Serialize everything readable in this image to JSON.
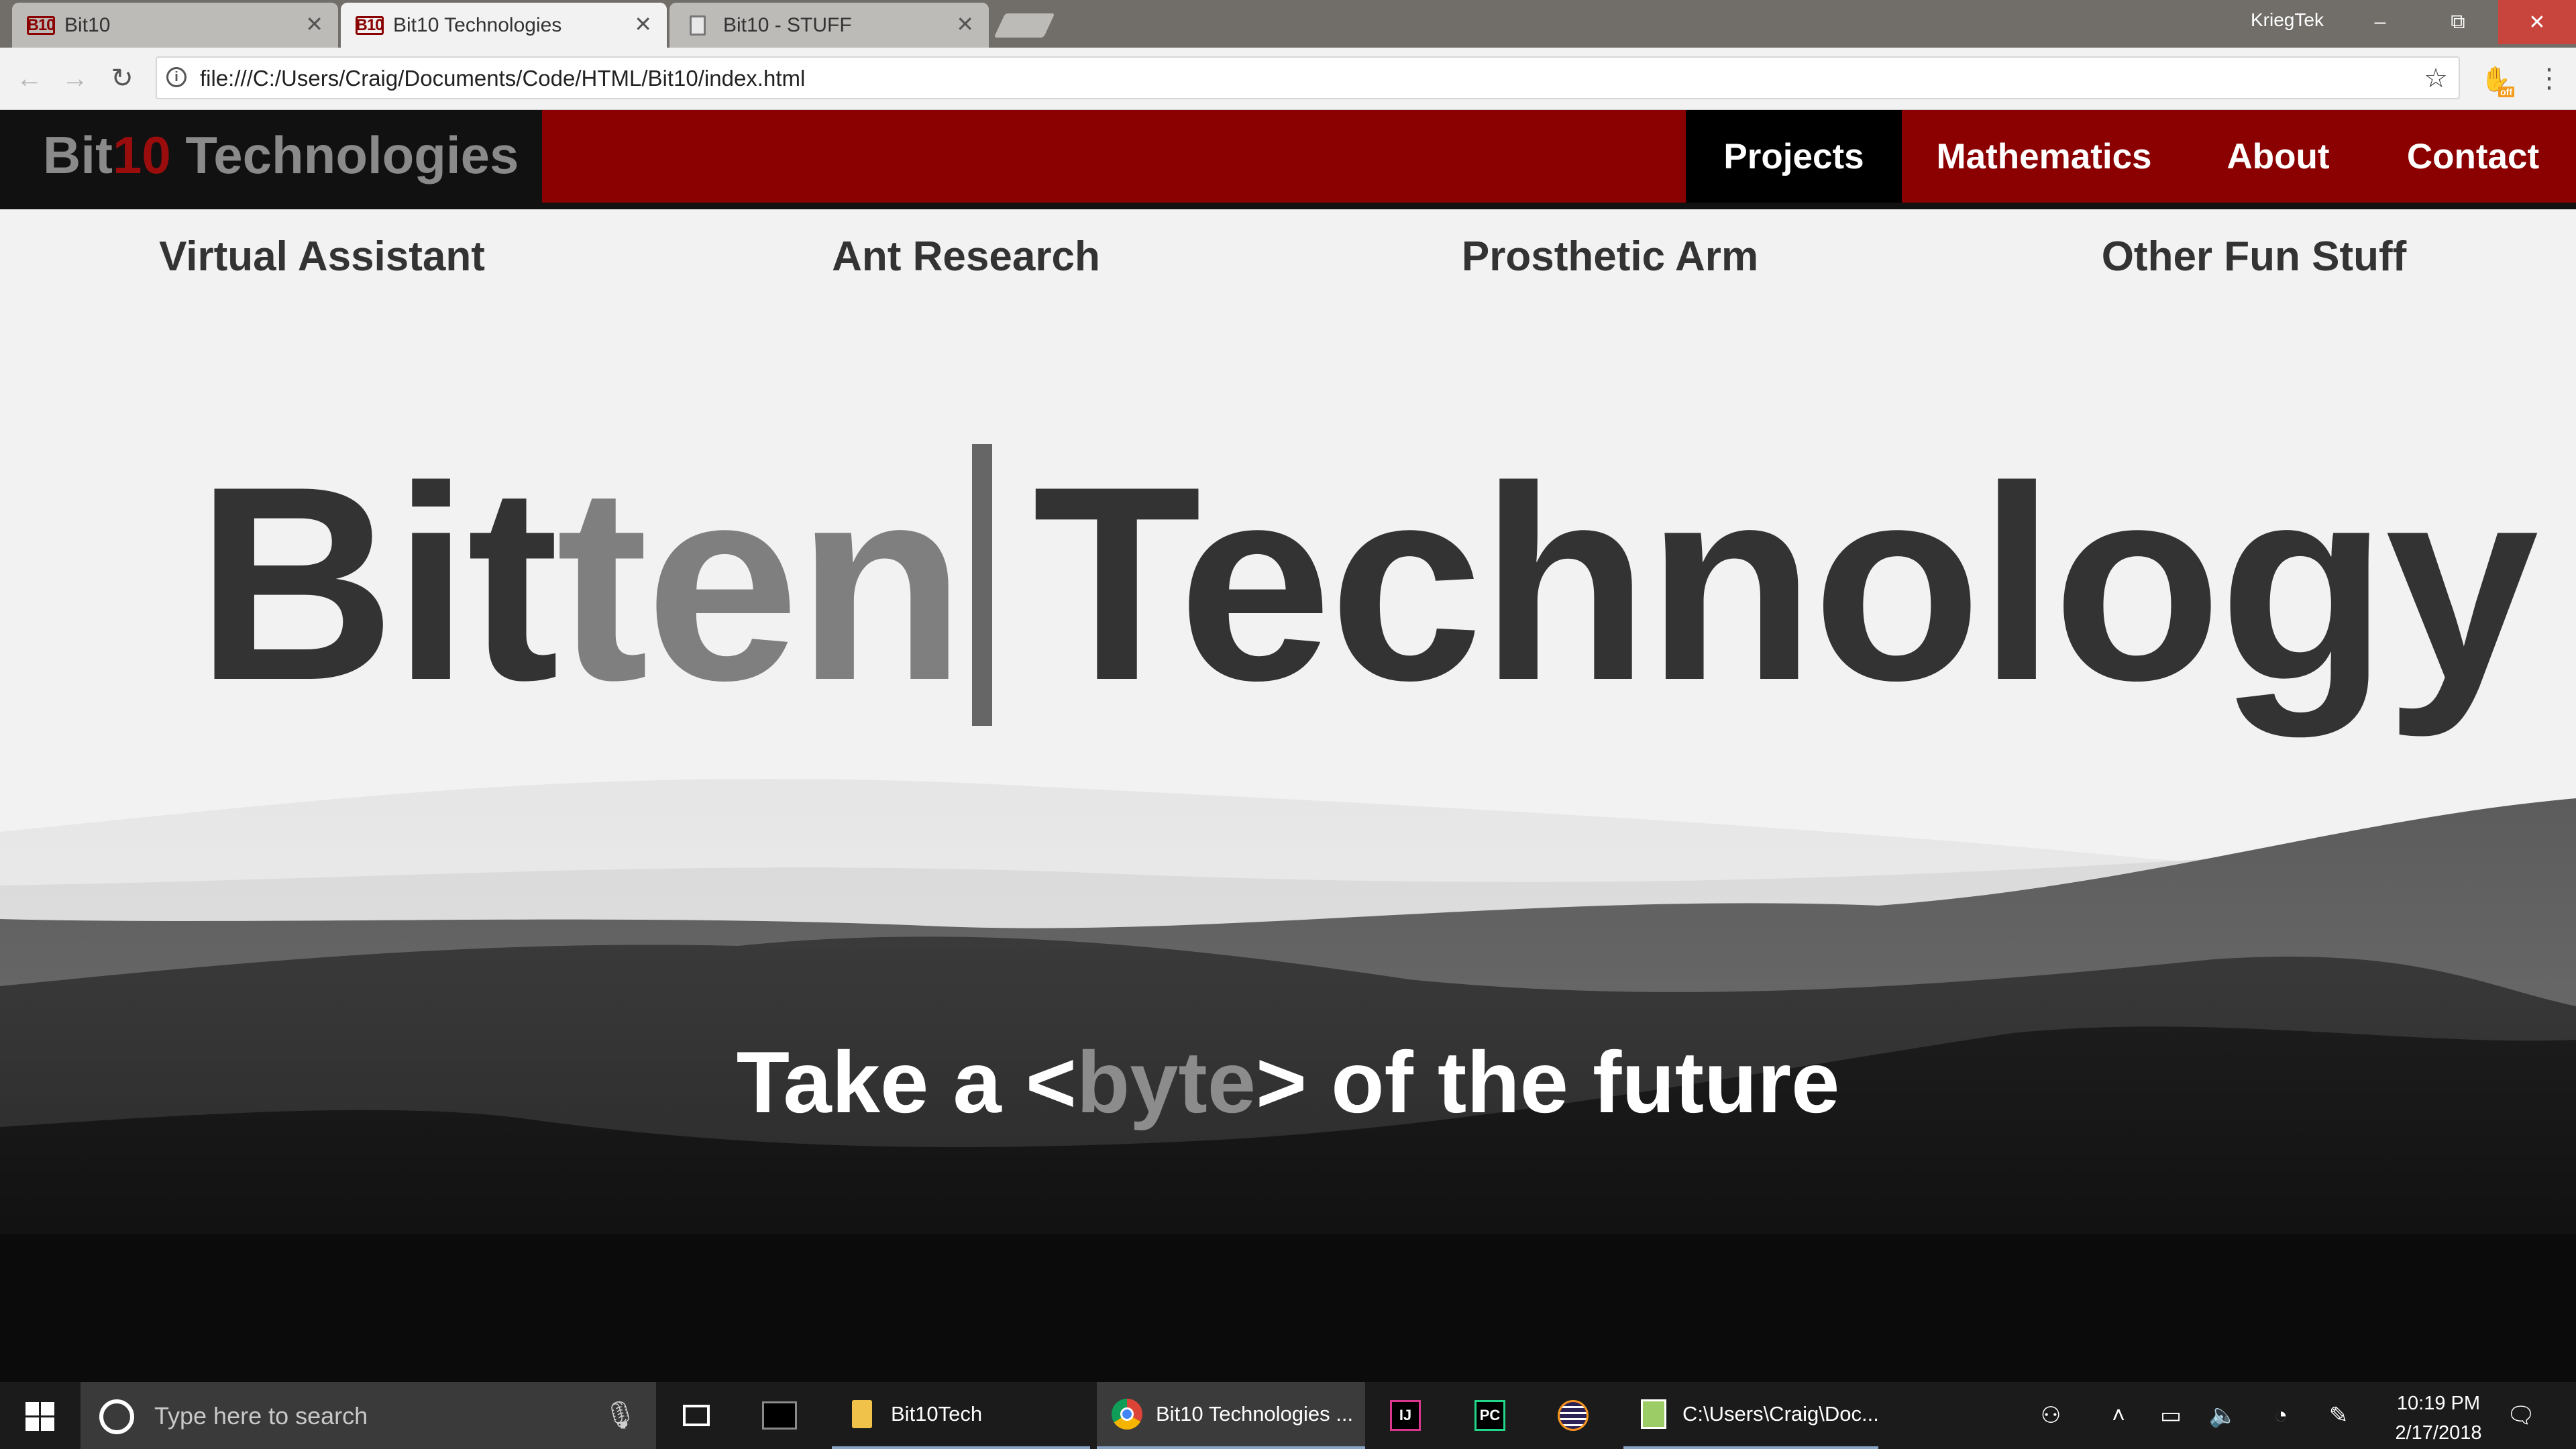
{
  "browser": {
    "tabs": [
      {
        "title": "Bit10",
        "favicon": "bit10-favicon",
        "active": false
      },
      {
        "title": "Bit10 Technologies",
        "favicon": "bit10-favicon",
        "active": true
      },
      {
        "title": "Bit10 - STUFF",
        "favicon": "document-icon",
        "active": false
      }
    ],
    "favicon_text": "B10",
    "profile_name": "KriegTek",
    "url": "file:///C:/Users/Craig/Documents/Code/HTML/Bit10/index.html",
    "extension_badge": "off"
  },
  "site": {
    "logo": {
      "part1": "Bit",
      "part2": "10",
      "part3": " Technologies"
    },
    "nav": [
      {
        "label": "Projects",
        "active": true
      },
      {
        "label": "Mathematics",
        "active": false
      },
      {
        "label": "About",
        "active": false
      },
      {
        "label": "Contact",
        "active": false
      }
    ],
    "subnav": [
      "Virtual Assistant",
      "Ant Research",
      "Prosthetic Arm",
      "Other Fun Stuff"
    ],
    "hero": {
      "word1_solid": "Bit",
      "word1_faded": "ten",
      "word2": "Technology"
    },
    "tagline": {
      "before": "Take a <",
      "highlight": "byte",
      "after": "> of the future"
    }
  },
  "taskbar": {
    "search_placeholder": "Type here to search",
    "apps": [
      {
        "label": "Bit10Tech",
        "icon": "folder-icon"
      },
      {
        "label": "Bit10 Technologies ...",
        "icon": "chrome-icon",
        "active": true
      },
      {
        "label": "",
        "icon": "intellij-icon"
      },
      {
        "label": "",
        "icon": "pycharm-icon"
      },
      {
        "label": "",
        "icon": "eclipse-icon"
      },
      {
        "label": "C:\\Users\\Craig\\Doc...",
        "icon": "notepad-icon"
      }
    ],
    "app_icon_text": {
      "intellij": "IJ",
      "pycharm": "PC"
    },
    "time": "10:19 PM",
    "date": "2/17/2018"
  },
  "colors": {
    "brand_red": "#8b0000",
    "header_black": "#111111",
    "text_dark": "#333333",
    "text_faded": "#7f7f7f"
  }
}
